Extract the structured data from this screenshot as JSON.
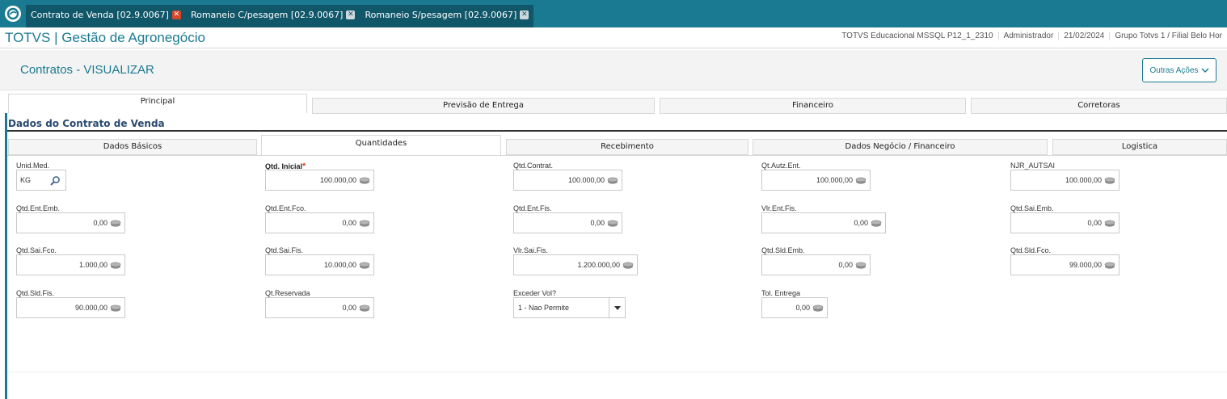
{
  "topbar": {
    "tabs": [
      {
        "label": "Contrato de Venda [02.9.0067]",
        "close": "red"
      },
      {
        "label": "Romaneio C/pesagem [02.9.0067]",
        "close": "grey"
      },
      {
        "label": "Romaneio S/pesagem [02.9.0067]",
        "close": "grey"
      }
    ]
  },
  "header": {
    "brand": "TOTVS",
    "separator": "|",
    "app_name": "Gestão de Agronegócio",
    "environment": "TOTVS Educacional MSSQL P12_1_2310",
    "user": "Administrador",
    "date": "21/02/2024",
    "branch": "Grupo Totvs 1 / Filial Belo Hor"
  },
  "page": {
    "title": "Contratos - VISUALIZAR",
    "actions_label": "Outras Ações"
  },
  "main_tabs": [
    "Principal",
    "Previsão de Entrega",
    "Financeiro",
    "Corretoras"
  ],
  "section_title": "Dados do Contrato de Venda",
  "sub_tabs": [
    "Dados Básicos",
    "Quantidades",
    "Recebimento",
    "Dados Negócio / Financeiro",
    "Logistica"
  ],
  "fields": {
    "unid_med": {
      "label": "Unid.Med.",
      "value": "KG"
    },
    "qtd_inicial": {
      "label": "Qtd. Inicial",
      "value": "100.000,00",
      "required": "*"
    },
    "qtd_contrat": {
      "label": "Qtd.Contrat.",
      "value": "100.000,00"
    },
    "qt_autz_ent": {
      "label": "Qt.Autz.Ent.",
      "value": "100.000,00"
    },
    "njr_autsai": {
      "label": "NJR_AUTSAI",
      "value": "100.000,00"
    },
    "qtd_ent_emb": {
      "label": "Qtd.Ent.Emb.",
      "value": "0,00"
    },
    "qtd_ent_fco": {
      "label": "Qtd.Ent.Fco.",
      "value": "0,00"
    },
    "qtd_ent_fis": {
      "label": "Qtd.Ent.Fis.",
      "value": "0,00"
    },
    "vlr_ent_fis": {
      "label": "Vlr.Ent.Fis.",
      "value": "0,00"
    },
    "qtd_sai_emb": {
      "label": "Qtd.Sai.Emb.",
      "value": "0,00"
    },
    "qtd_sai_fco": {
      "label": "Qtd.Sai.Fco.",
      "value": "1.000,00"
    },
    "qtd_sai_fis": {
      "label": "Qtd.Sai.Fis.",
      "value": "10.000,00"
    },
    "vlr_sai_fis": {
      "label": "Vlr.Sai.Fis.",
      "value": "1.200.000,00"
    },
    "qtd_sld_emb": {
      "label": "Qtd.Sld.Emb.",
      "value": "0,00"
    },
    "qtd_sld_fco": {
      "label": "Qtd.Sld.Fco.",
      "value": "99.000,00"
    },
    "qtd_sld_fis": {
      "label": "Qtd.Sld.Fis.",
      "value": "90.000,00"
    },
    "qt_reservada": {
      "label": "Qt.Reservada",
      "value": "0,00"
    },
    "exceder_vol": {
      "label": "Exceder Vol?",
      "value": "1 - Nao Permite"
    },
    "tol_entrega": {
      "label": "Tol. Entrega",
      "value": "0,00"
    }
  },
  "colors": {
    "accent": "#1a7a91",
    "topbar_dark": "#10576a",
    "close_red": "#d9472b"
  },
  "icons": {
    "logo": "totvs-logo-icon",
    "search": "search-icon",
    "coin": "coins-icon",
    "dropdown": "chevron-down-icon"
  }
}
